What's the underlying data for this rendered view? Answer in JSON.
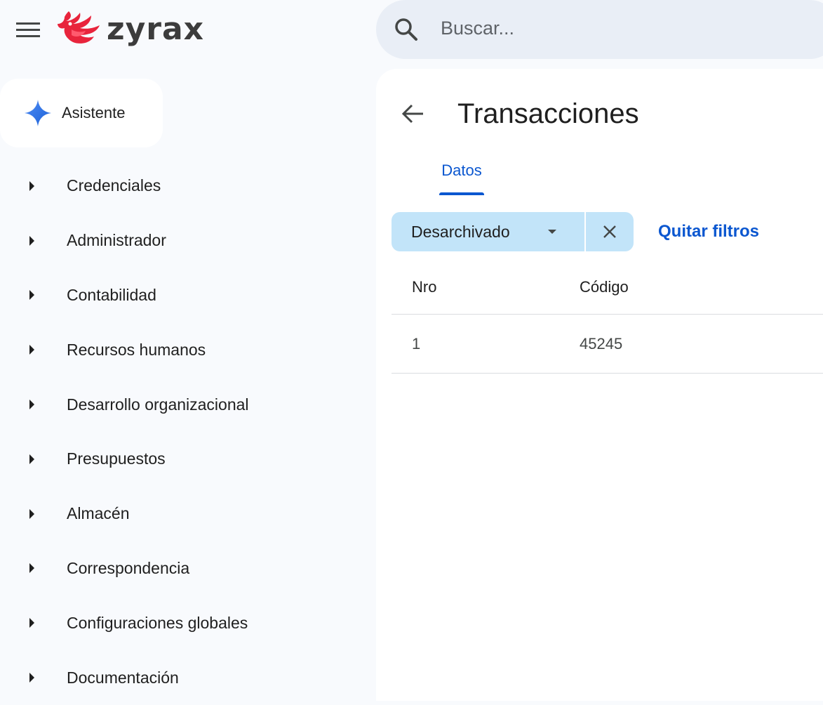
{
  "header": {
    "logo_text": "zyrax",
    "search": {
      "placeholder": "Buscar..."
    }
  },
  "sidebar": {
    "assistant_label": "Asistente",
    "items": [
      {
        "label": "Credenciales"
      },
      {
        "label": "Administrador"
      },
      {
        "label": "Contabilidad"
      },
      {
        "label": "Recursos humanos"
      },
      {
        "label": "Desarrollo organizacional"
      },
      {
        "label": "Presupuestos"
      },
      {
        "label": "Almacén"
      },
      {
        "label": "Correspondencia"
      },
      {
        "label": "Configuraciones globales"
      },
      {
        "label": "Documentación"
      }
    ]
  },
  "main": {
    "title": "Transacciones",
    "tabs": [
      {
        "label": "Datos",
        "active": true
      }
    ],
    "filter_chip": {
      "label": "Desarchivado"
    },
    "clear_filters_label": "Quitar filtros",
    "table": {
      "columns": [
        "Nro",
        "Código"
      ],
      "rows": [
        [
          "1",
          "45245"
        ]
      ]
    }
  },
  "colors": {
    "accent": "#0b57d0",
    "chip_bg": "#c2e4f9",
    "search_bg": "#e9eef6",
    "logo_red": "#e8243c"
  }
}
